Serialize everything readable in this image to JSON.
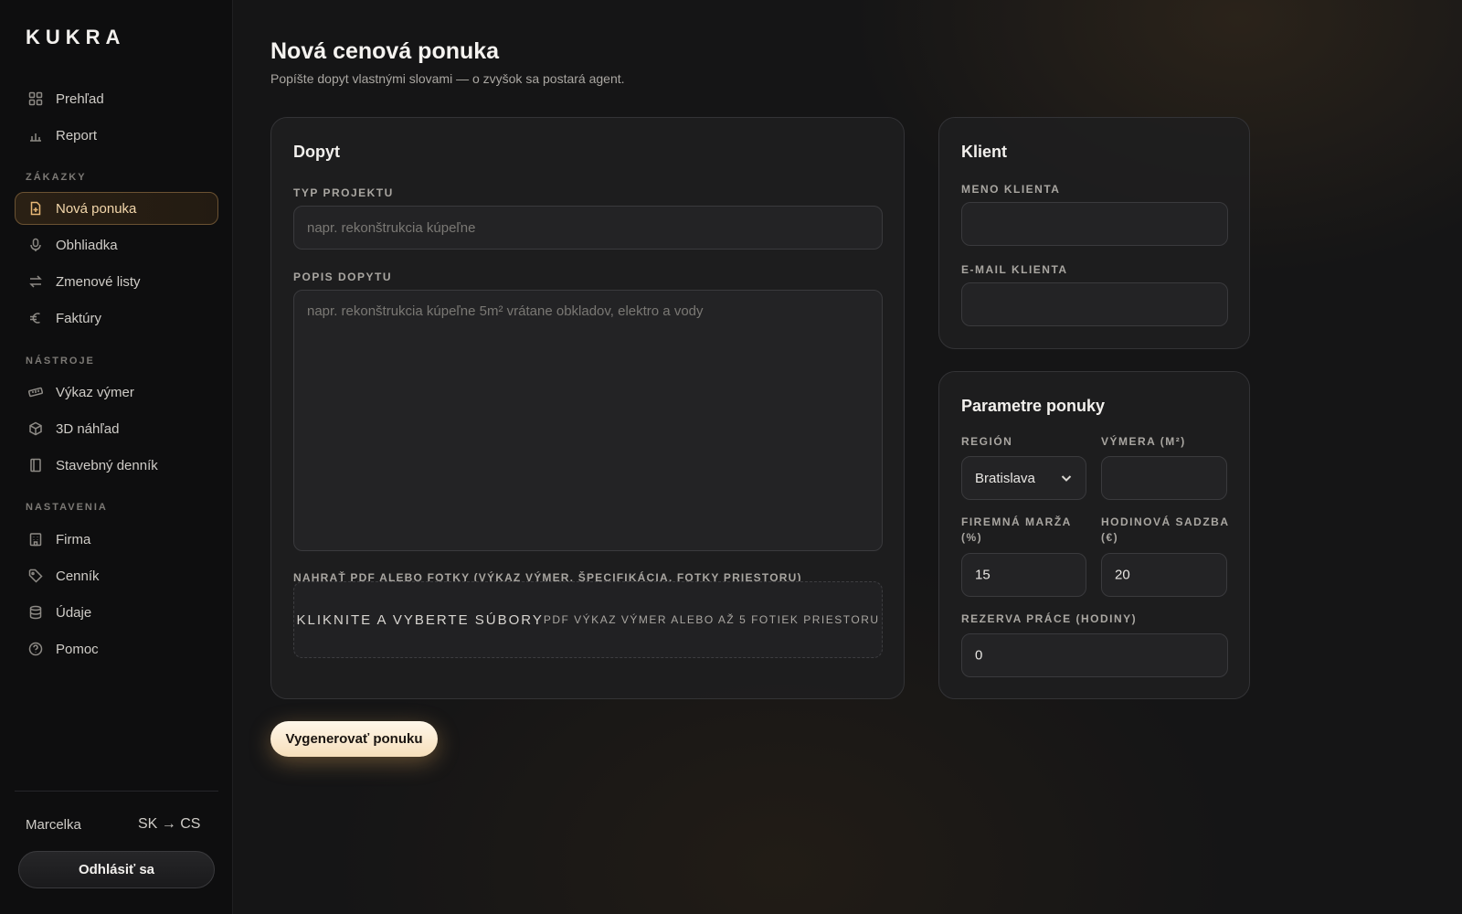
{
  "app": {
    "logo": "KUKRA"
  },
  "sidebar": {
    "top_items": [
      {
        "label": "Prehľad",
        "icon": "grid-icon"
      },
      {
        "label": "Report",
        "icon": "bar-chart-icon"
      }
    ],
    "sections": [
      {
        "label": "ZÁKAZKY",
        "items": [
          {
            "label": "Nová ponuka",
            "icon": "file-plus-icon",
            "active": true
          },
          {
            "label": "Obhliadka",
            "icon": "microphone-icon"
          },
          {
            "label": "Zmenové listy",
            "icon": "swap-arrows-icon"
          },
          {
            "label": "Faktúry",
            "icon": "euro-icon"
          }
        ]
      },
      {
        "label": "NÁSTROJE",
        "items": [
          {
            "label": "Výkaz výmer",
            "icon": "ruler-icon"
          },
          {
            "label": "3D náhľad",
            "icon": "cube-icon"
          },
          {
            "label": "Stavebný denník",
            "icon": "book-icon"
          }
        ]
      },
      {
        "label": "NASTAVENIA",
        "items": [
          {
            "label": "Firma",
            "icon": "building-icon"
          },
          {
            "label": "Cenník",
            "icon": "tag-icon"
          },
          {
            "label": "Údaje",
            "icon": "database-icon"
          },
          {
            "label": "Pomoc",
            "icon": "help-circle-icon"
          }
        ]
      }
    ],
    "user_name": "Marcelka",
    "language_switch": "SK → CS",
    "logout_label": "Odhlásiť sa"
  },
  "page": {
    "title": "Nová cenová ponuka",
    "subtitle": "Popíšte dopyt vlastnými slovami — o zvyšok sa postará agent."
  },
  "demand_card": {
    "title": "Dopyt",
    "project_type_label": "TYP PROJEKTU",
    "project_type_placeholder": "napr. rekonštrukcia kúpeľne",
    "project_type_value": "",
    "description_label": "POPIS DOPYTU",
    "description_placeholder": "napr. rekonštrukcia kúpeľne 5m² vrátane obkladov, elektro a vody",
    "description_value": "",
    "upload_label": "NAHRAŤ PDF ALEBO FOTKY (VÝKAZ VÝMER, ŠPECIFIKÁCIA, FOTKY PRIESTORU)",
    "upload_main": "KLIKNITE A VYBERTE SÚBORY",
    "upload_sub": "PDF VÝKAZ VÝMER ALEBO AŽ 5 FOTIEK PRIESTORU"
  },
  "client_card": {
    "title": "Klient",
    "name_label": "MENO KLIENTA",
    "name_value": "",
    "email_label": "E-MAIL KLIENTA",
    "email_value": ""
  },
  "params_card": {
    "title": "Parametre ponuky",
    "region_label": "REGIÓN",
    "region_value": "Bratislava",
    "area_label": "VÝMERA (M²)",
    "area_value": "",
    "margin_label_line1": "FIREMNÁ MARŽA",
    "margin_label_line2": "(%)",
    "margin_value": "15",
    "hourly_label_line1": "HODINOVÁ SADZBA",
    "hourly_label_line2": "(€)",
    "hourly_value": "20",
    "reserve_label": "REZERVA PRÁCE (HODINY)",
    "reserve_value": "0"
  },
  "actions": {
    "generate_label": "Vygenerovať ponuku"
  },
  "colors": {
    "accent": "#e8b877",
    "background": "#151516",
    "card": "#1e1e20"
  }
}
